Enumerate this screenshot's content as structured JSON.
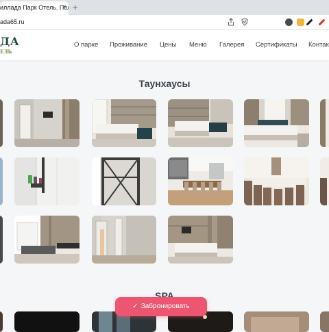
{
  "browser": {
    "tab_title": "иллада Парк Отель. Полно",
    "tab_close": "×",
    "new_tab": "+",
    "url": "ada65.ru"
  },
  "site": {
    "logo_top": "ДА",
    "logo_bottom": "ЕЛЬ",
    "nav": [
      "О парке",
      "Проживание",
      "Цены",
      "Меню",
      "Галерея",
      "Сертификаты",
      "Контакт"
    ]
  },
  "sections": {
    "townhouses_title": "Таунхаусы",
    "spa_title": "SPA"
  },
  "cta": {
    "book_label": "Забронировать",
    "check_glyph": "✓"
  },
  "colors": {
    "accent": "#ec5670",
    "logo_green": "#1f4d3a",
    "page_bg": "#f5f6f8"
  },
  "icons": [
    "share-icon",
    "shield-icon",
    "extension-icon",
    "pen-icon",
    "close-icon",
    "check-icon"
  ]
}
